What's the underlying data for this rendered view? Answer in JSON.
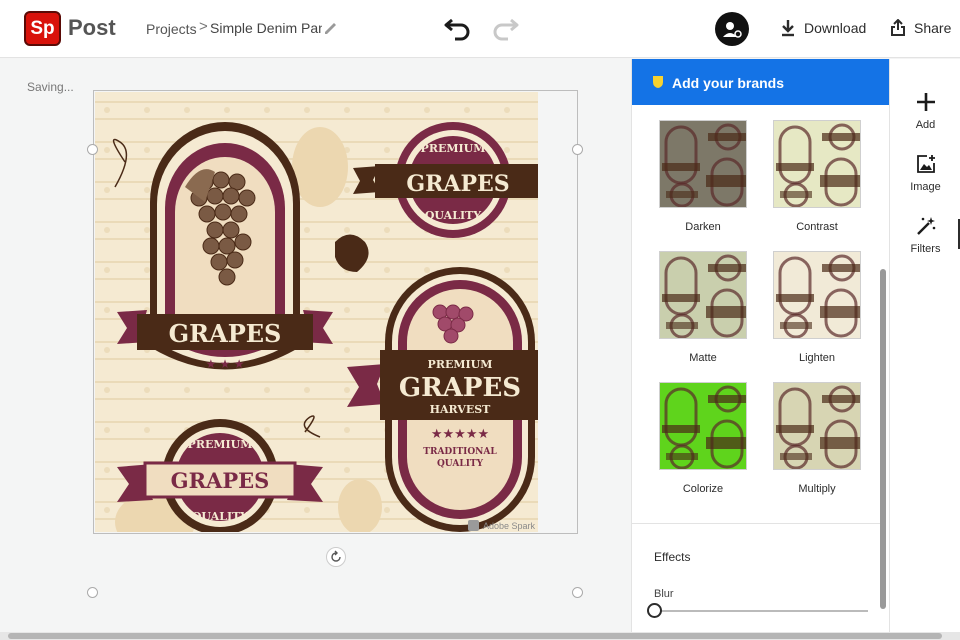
{
  "app": {
    "logo_text": "Sp",
    "name": "Post"
  },
  "breadcrumb": {
    "projects": "Projects",
    "separator": ">",
    "document": "Simple Denim Pants"
  },
  "header": {
    "download_label": "Download",
    "share_label": "Share"
  },
  "canvas": {
    "status": "Saving...",
    "artwork": {
      "label_1": "GRAPES",
      "label_2_top": "PREMIUM",
      "label_2_main": "GRAPES",
      "label_2_bottom": "QUALITY",
      "label_3_top": "PREMIUM",
      "label_3_main": "GRAPES",
      "label_3_sub": "HARVEST",
      "label_3_foot": "TRADITIONAL",
      "label_3_foot2": "QUALITY",
      "label_4_top": "PREMIUM",
      "label_4_main": "GRAPES",
      "label_4_bottom": "QUALITY",
      "watermark": "Adobe Spark"
    }
  },
  "panel": {
    "brand_banner": "Add your brands",
    "filters": [
      {
        "name": "Darken",
        "tint": "#7d7868"
      },
      {
        "name": "Contrast",
        "tint": "#e6e8c4"
      },
      {
        "name": "Matte",
        "tint": "#c9cfad"
      },
      {
        "name": "Lighten",
        "tint": "#f1ead7"
      },
      {
        "name": "Colorize",
        "tint": "#5fd41c"
      },
      {
        "name": "Multiply",
        "tint": "#d7d5b3"
      }
    ],
    "effects_title": "Effects",
    "blur_label": "Blur",
    "blur_value": 0
  },
  "rail": {
    "add": "Add",
    "image": "Image",
    "filters": "Filters"
  },
  "colors": {
    "accent": "#1473e6",
    "logo": "#d9120b",
    "label_maroon": "#7a2a46",
    "label_brown": "#4a2a17",
    "cream": "#f5ead2"
  }
}
